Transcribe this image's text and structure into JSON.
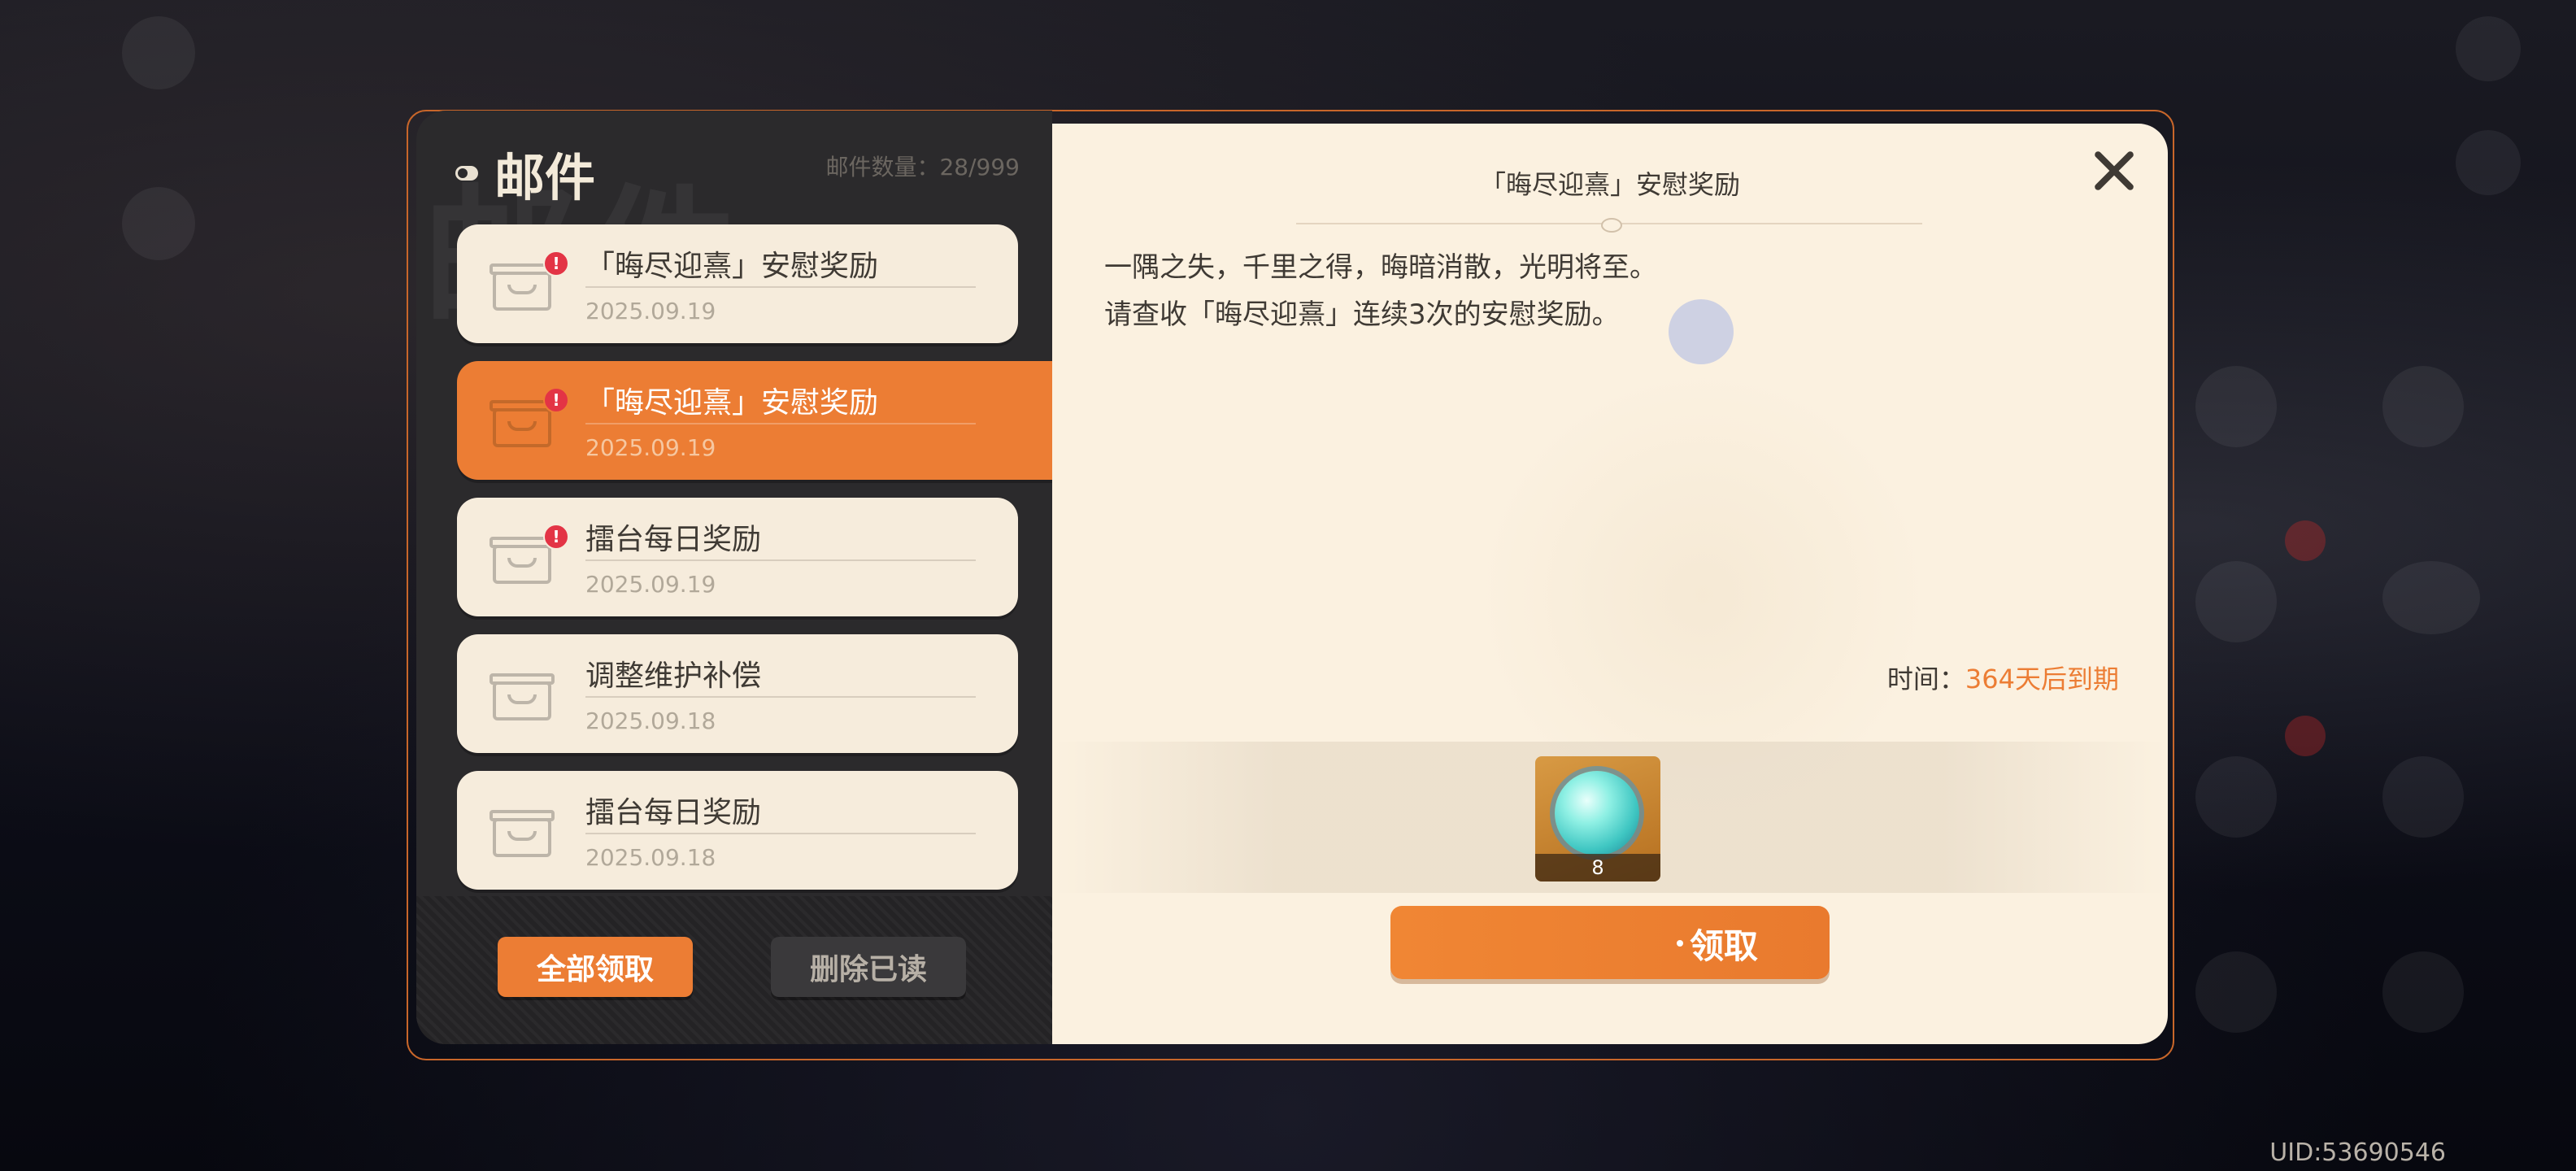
{
  "mail_panel": {
    "title": "邮件",
    "watermark": "邮件",
    "count": "邮件数量：28/999",
    "items": [
      {
        "title": "「晦尽迎熹」安慰奖励",
        "date": "2025.09.19",
        "unread": true,
        "active": false
      },
      {
        "title": "「晦尽迎熹」安慰奖励",
        "date": "2025.09.19",
        "unread": true,
        "active": true
      },
      {
        "title": "擂台每日奖励",
        "date": "2025.09.19",
        "unread": true,
        "active": false
      },
      {
        "title": "调整维护补偿",
        "date": "2025.09.18",
        "unread": false,
        "active": false
      },
      {
        "title": "擂台每日奖励",
        "date": "2025.09.18",
        "unread": false,
        "active": false
      }
    ],
    "badge_symbol": "!",
    "claim_all": "全部领取",
    "delete_read": "删除已读"
  },
  "detail": {
    "header": "「晦尽迎熹」安慰奖励",
    "body_line1": "一隅之失，千里之得，晦暗消散，光明将至。",
    "body_line2": "请查收「晦尽迎熹」连续3次的安慰奖励。",
    "expire_label": "时间：",
    "expire_value": "364天后到期",
    "reward": {
      "icon": "spirit-orb-icon",
      "count": "8"
    },
    "claim": "领取"
  },
  "uid": "UID:53690546",
  "colors": {
    "accent": "#ec7d34",
    "panel_dark": "#2b2a2c",
    "panel_light": "#fbf1e0",
    "badge": "#e33445"
  }
}
